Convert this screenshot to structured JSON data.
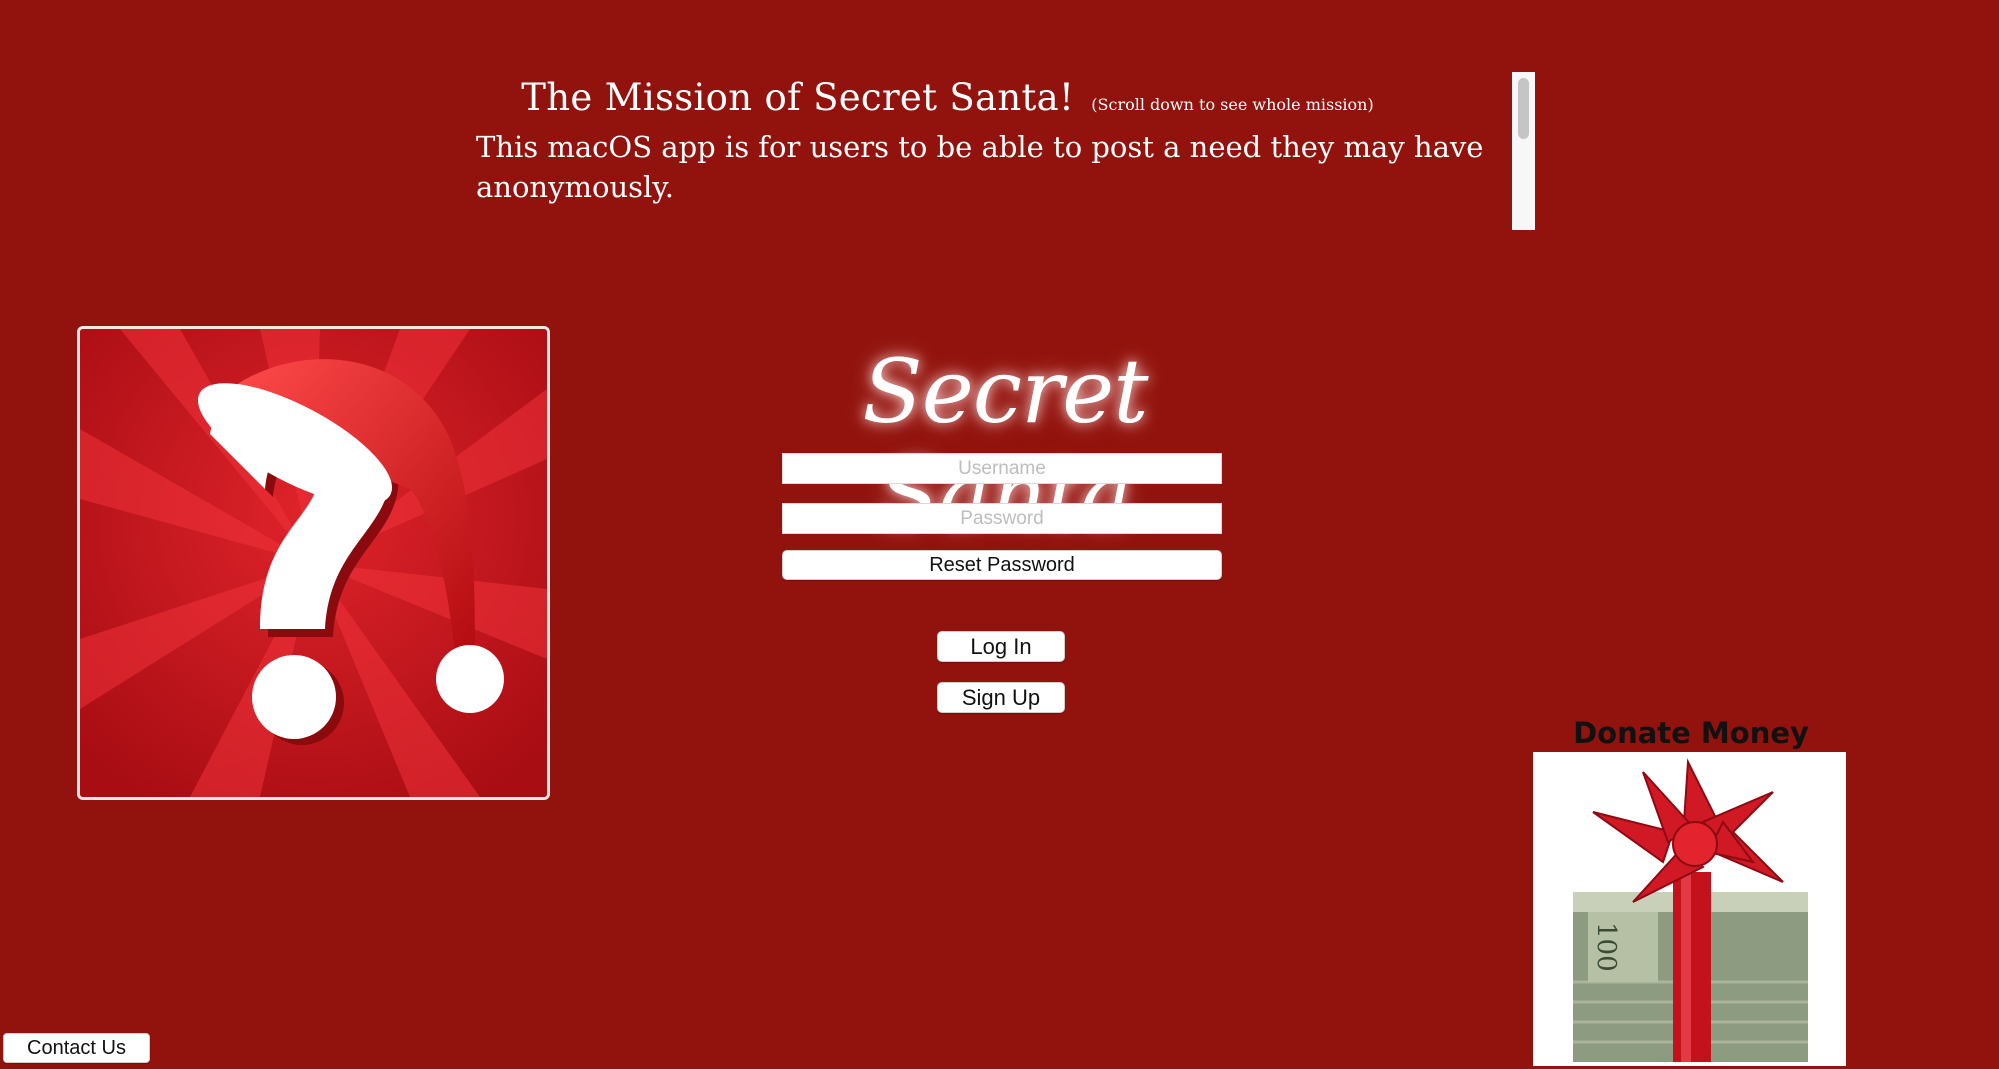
{
  "mission": {
    "title": "The Mission of  Secret Santa!",
    "note": "(Scroll down to see whole mission)",
    "paragraph_1": "This macOS app is for users to be able to post a need they may have anonymously."
  },
  "login": {
    "brand": "Secret Santa",
    "username_placeholder": "Username",
    "password_placeholder": "Password",
    "reset_label": "Reset Password",
    "login_label": "Log In",
    "signup_label": "Sign Up"
  },
  "donate": {
    "title": "Donate Money",
    "bill_text": "100"
  },
  "footer": {
    "contact_label": "Contact Us"
  },
  "colors": {
    "background": "#92130d",
    "santa_red": "#c2151c"
  },
  "icons": {
    "logo": "santa-hat-question-icon",
    "donate": "money-gift-bow-icon"
  }
}
